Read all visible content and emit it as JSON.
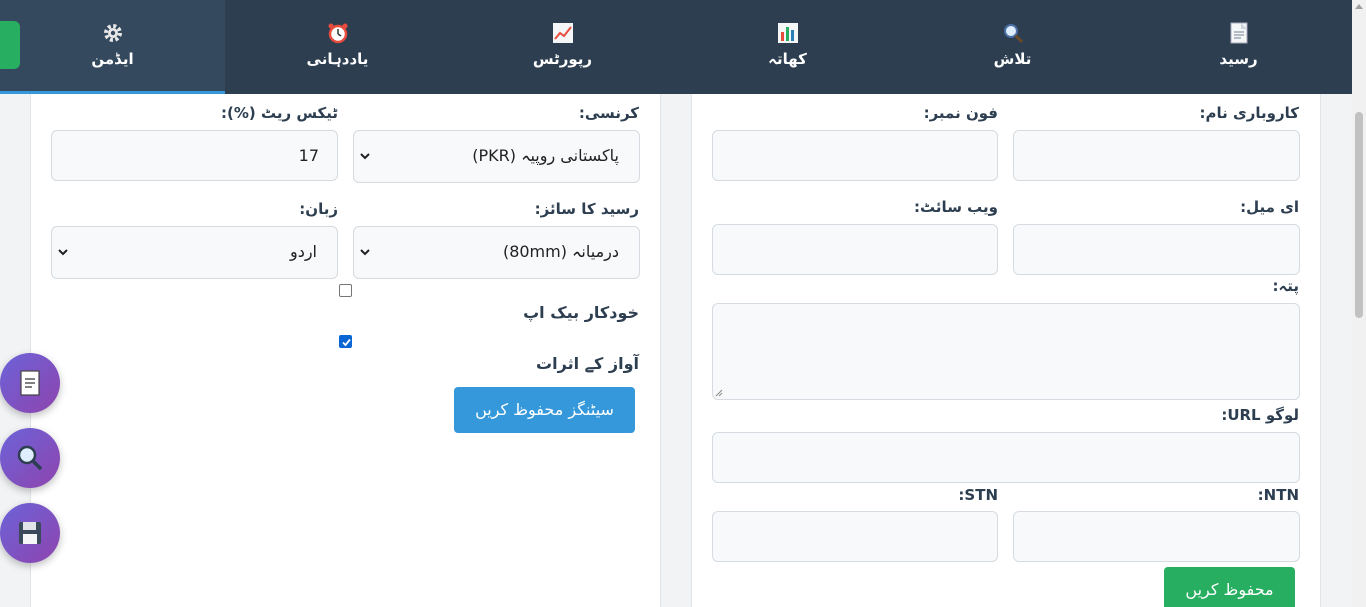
{
  "nav": {
    "items": [
      {
        "label": "رسید",
        "icon": "receipt-icon"
      },
      {
        "label": "تلاش",
        "icon": "search-icon"
      },
      {
        "label": "کھاتہ",
        "icon": "bar-chart-icon"
      },
      {
        "label": "رپورٹس",
        "icon": "line-chart-icon"
      },
      {
        "label": "یاددہانی",
        "icon": "alarm-clock-icon"
      },
      {
        "label": "ایڈمن",
        "icon": "gear-icon"
      }
    ],
    "active": "ایڈمن"
  },
  "business": {
    "name_label": "کاروباری نام:",
    "name_value": "",
    "phone_label": "فون نمبر:",
    "phone_value": "",
    "email_label": "ای میل:",
    "email_value": "",
    "website_label": "ویب سائٹ:",
    "website_value": "",
    "address_label": "پتہ:",
    "address_value": "",
    "logo_label": "لوگو URL:",
    "logo_value": "",
    "ntn_label": "NTN:",
    "ntn_value": "",
    "stn_label": "STN:",
    "stn_value": "",
    "save_label": "محفوظ کریں"
  },
  "settings": {
    "currency_label": "کرنسی:",
    "currency_value": "پاکستانی روپیہ (PKR)",
    "tax_label": "ٹیکس ریٹ (%):",
    "tax_value": "17",
    "receipt_size_label": "رسید کا سائز:",
    "receipt_size_value": "درمیانہ (80mm)",
    "language_label": "زبان:",
    "language_value": "اردو",
    "auto_backup_label": "خودکار بیک اپ",
    "auto_backup_checked": false,
    "sound_effects_label": "آواز کے اثرات",
    "sound_effects_checked": true,
    "save_label": "سیٹنگز محفوظ کریں"
  },
  "fabs": [
    {
      "icon": "receipt-icon"
    },
    {
      "icon": "search-icon"
    },
    {
      "icon": "floppy-disk-icon"
    }
  ],
  "colors": {
    "nav_bg": "#2c3e50",
    "accent_blue": "#3498db",
    "accent_green": "#27ae60",
    "fab_purple": "#7b4fc8"
  }
}
